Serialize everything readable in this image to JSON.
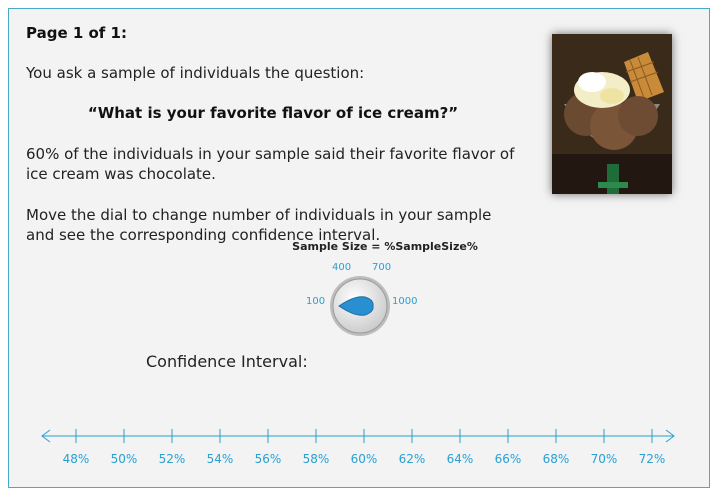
{
  "page": {
    "label": "Page 1 of 1:"
  },
  "question_block": {
    "intro": "You ask a sample of individuals the question:",
    "question": "“What is your favorite flavor of ice cream?”",
    "result": "60% of the individuals in your sample said their favorite flavor of ice cream was chocolate.",
    "instruction": "Move the dial to change number of individuals in your sample and see the corresponding confidence interval."
  },
  "image": {
    "alt": "ice cream sundae"
  },
  "dial": {
    "title": "Sample Size = %SampleSize%",
    "ticks": {
      "t100": "100",
      "t400": "400",
      "t700": "700",
      "t1000": "1000"
    },
    "selected": "100"
  },
  "confidence": {
    "label": "Confidence Interval:"
  },
  "axis": {
    "labels": [
      "48%",
      "50%",
      "52%",
      "54%",
      "56%",
      "58%",
      "60%",
      "62%",
      "64%",
      "66%",
      "68%",
      "70%",
      "72%"
    ],
    "color": "#2a9fd0"
  }
}
